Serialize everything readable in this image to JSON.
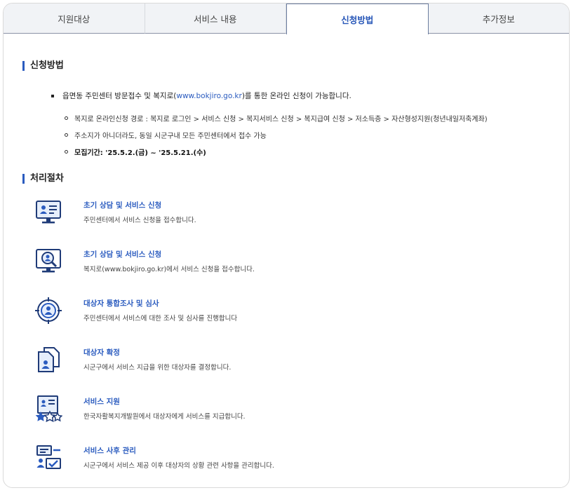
{
  "tabs": [
    {
      "label": "지원대상"
    },
    {
      "label": "서비스 내용"
    },
    {
      "label": "신청방법"
    },
    {
      "label": "추가정보"
    }
  ],
  "active_tab": "신청방법",
  "method": {
    "title": "신청방법",
    "main_prefix": "읍면동 주민센터 방문접수 및 복지로(",
    "main_link": "www.bokjiro.go.kr",
    "main_suffix": ")를 통한 온라인 신청이 가능합니다.",
    "details": [
      "복지로 온라인신청 경로 : 복지로 로그인 > 서비스 신청 > 복지서비스 신청 > 복지급여 신청 > 저소득층 > 자산형성지원(청년내일저축계좌)",
      "주소지가 아니더라도, 동일 시군구내 모든 주민센터에서 접수 가능",
      "모집기간: '25.5.2.(금) ~ '25.5.21.(수)"
    ]
  },
  "procedure": {
    "title": "처리절차",
    "steps": [
      {
        "title": "초기 상담 및 서비스 신청",
        "desc": "주민센터에서 서비스 신청을 접수합니다.",
        "icon": "monitor-profile-icon"
      },
      {
        "title": "초기 상담 및 서비스 신청",
        "desc": "복지로(www.bokjiro.go.kr)에서 서비스 신청을 접수합니다.",
        "icon": "monitor-search-user-icon"
      },
      {
        "title": "대상자 통합조사 및 심사",
        "desc": "주민센터에서 서비스에 대한 조사 및 심사를 진행합니다",
        "icon": "target-user-icon"
      },
      {
        "title": "대상자 확정",
        "desc": "시군구에서 서비스 지급을 위한 대상자를 결정합니다.",
        "icon": "documents-user-icon"
      },
      {
        "title": "서비스 지원",
        "desc": "한국자활복지개발원에서 대상자에게 서비스를 지급합니다.",
        "icon": "certificate-stars-icon"
      },
      {
        "title": "서비스 사후 관리",
        "desc": "시군구에서 서비스 제공 이후 대상자의 상황 관련 사항을 관리합니다.",
        "icon": "user-checklist-icon"
      }
    ]
  },
  "colors": {
    "accent": "#2a5bbf",
    "icon_dark": "#1f3b78",
    "border": "#d9d9d9"
  }
}
